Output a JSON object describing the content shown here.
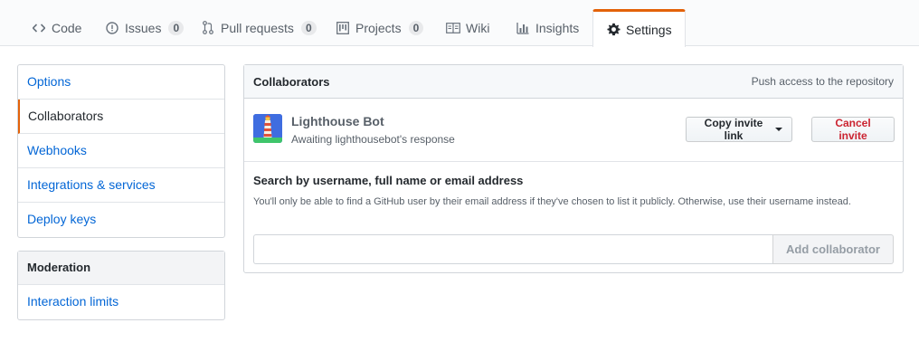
{
  "repo_nav": {
    "tabs": [
      {
        "label": "Code",
        "icon": "code-icon"
      },
      {
        "label": "Issues",
        "icon": "issue-opened-icon",
        "count": "0"
      },
      {
        "label": "Pull requests",
        "icon": "git-pull-request-icon",
        "count": "0"
      },
      {
        "label": "Projects",
        "icon": "project-icon",
        "count": "0"
      },
      {
        "label": "Wiki",
        "icon": "book-icon"
      },
      {
        "label": "Insights",
        "icon": "graph-icon"
      },
      {
        "label": "Settings",
        "icon": "gear-icon",
        "selected": true
      }
    ],
    "accent_color": "#e36209"
  },
  "sidebar": {
    "items": [
      {
        "label": "Options"
      },
      {
        "label": "Collaborators",
        "selected": true
      },
      {
        "label": "Webhooks"
      },
      {
        "label": "Integrations & services"
      },
      {
        "label": "Deploy keys"
      }
    ],
    "moderation": {
      "heading": "Moderation",
      "items": [
        {
          "label": "Interaction limits"
        }
      ]
    }
  },
  "collaborators": {
    "title": "Collaborators",
    "note": "Push access to the repository",
    "invite": {
      "name": "Lighthouse Bot",
      "status": "Awaiting lighthousebot's response",
      "copy_label": "Copy invite link",
      "cancel_label": "Cancel invite",
      "avatar_icon": "lighthouse-avatar"
    },
    "search": {
      "label": "Search by username, full name or email address",
      "note": "You'll only be able to find a GitHub user by their email address if they've chosen to list it publicly. Otherwise, use their username instead.",
      "value": "",
      "placeholder": "",
      "button_label": "Add collaborator"
    }
  }
}
